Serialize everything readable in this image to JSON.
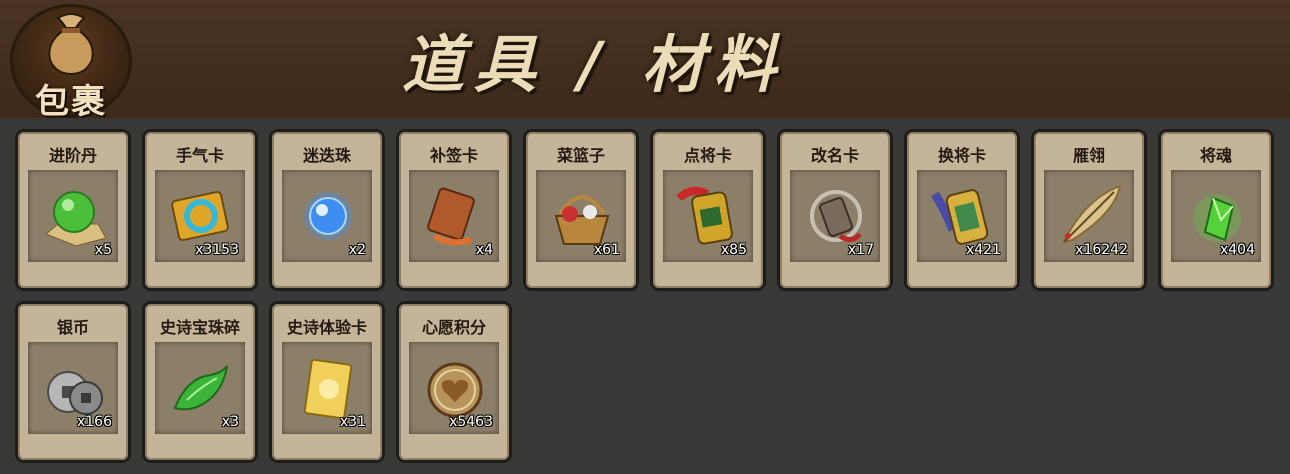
{
  "header": {
    "bag_label": "包裹",
    "title": "道具 / 材料"
  },
  "items": [
    {
      "name": "进阶丹",
      "qty": "x5",
      "icon": "green-orb-icon",
      "color": "#4cbf3a"
    },
    {
      "name": "手气卡",
      "qty": "x3153",
      "icon": "luck-card-icon",
      "color": "#e0a62a"
    },
    {
      "name": "迷迭珠",
      "qty": "x2",
      "icon": "blue-orb-icon",
      "color": "#3d8ef0"
    },
    {
      "name": "补签卡",
      "qty": "x4",
      "icon": "sign-card-icon",
      "color": "#b05a2c"
    },
    {
      "name": "菜篮子",
      "qty": "x61",
      "icon": "basket-icon",
      "color": "#b8863c"
    },
    {
      "name": "点将卡",
      "qty": "x85",
      "icon": "general-token-icon",
      "color": "#d1a52a"
    },
    {
      "name": "改名卡",
      "qty": "x17",
      "icon": "rename-token-icon",
      "color": "#7a6a5c"
    },
    {
      "name": "换将卡",
      "qty": "x421",
      "icon": "swap-token-icon",
      "color": "#3f8a4a"
    },
    {
      "name": "雁翎",
      "qty": "x16242",
      "icon": "feather-icon",
      "color": "#d8c48e"
    },
    {
      "name": "将魂",
      "qty": "x404",
      "icon": "green-crystal-icon",
      "color": "#55d23a"
    },
    {
      "name": "银币",
      "qty": "x166",
      "icon": "silver-coin-icon",
      "color": "#b6b6b6"
    },
    {
      "name": "史诗宝珠碎",
      "qty": "x3",
      "icon": "green-shard-icon",
      "color": "#3cb43a"
    },
    {
      "name": "史诗体验卡",
      "qty": "x31",
      "icon": "gold-card-icon",
      "color": "#f0cf5a"
    },
    {
      "name": "心愿积分",
      "qty": "x5463",
      "icon": "heart-coin-icon",
      "color": "#b8945c"
    }
  ]
}
